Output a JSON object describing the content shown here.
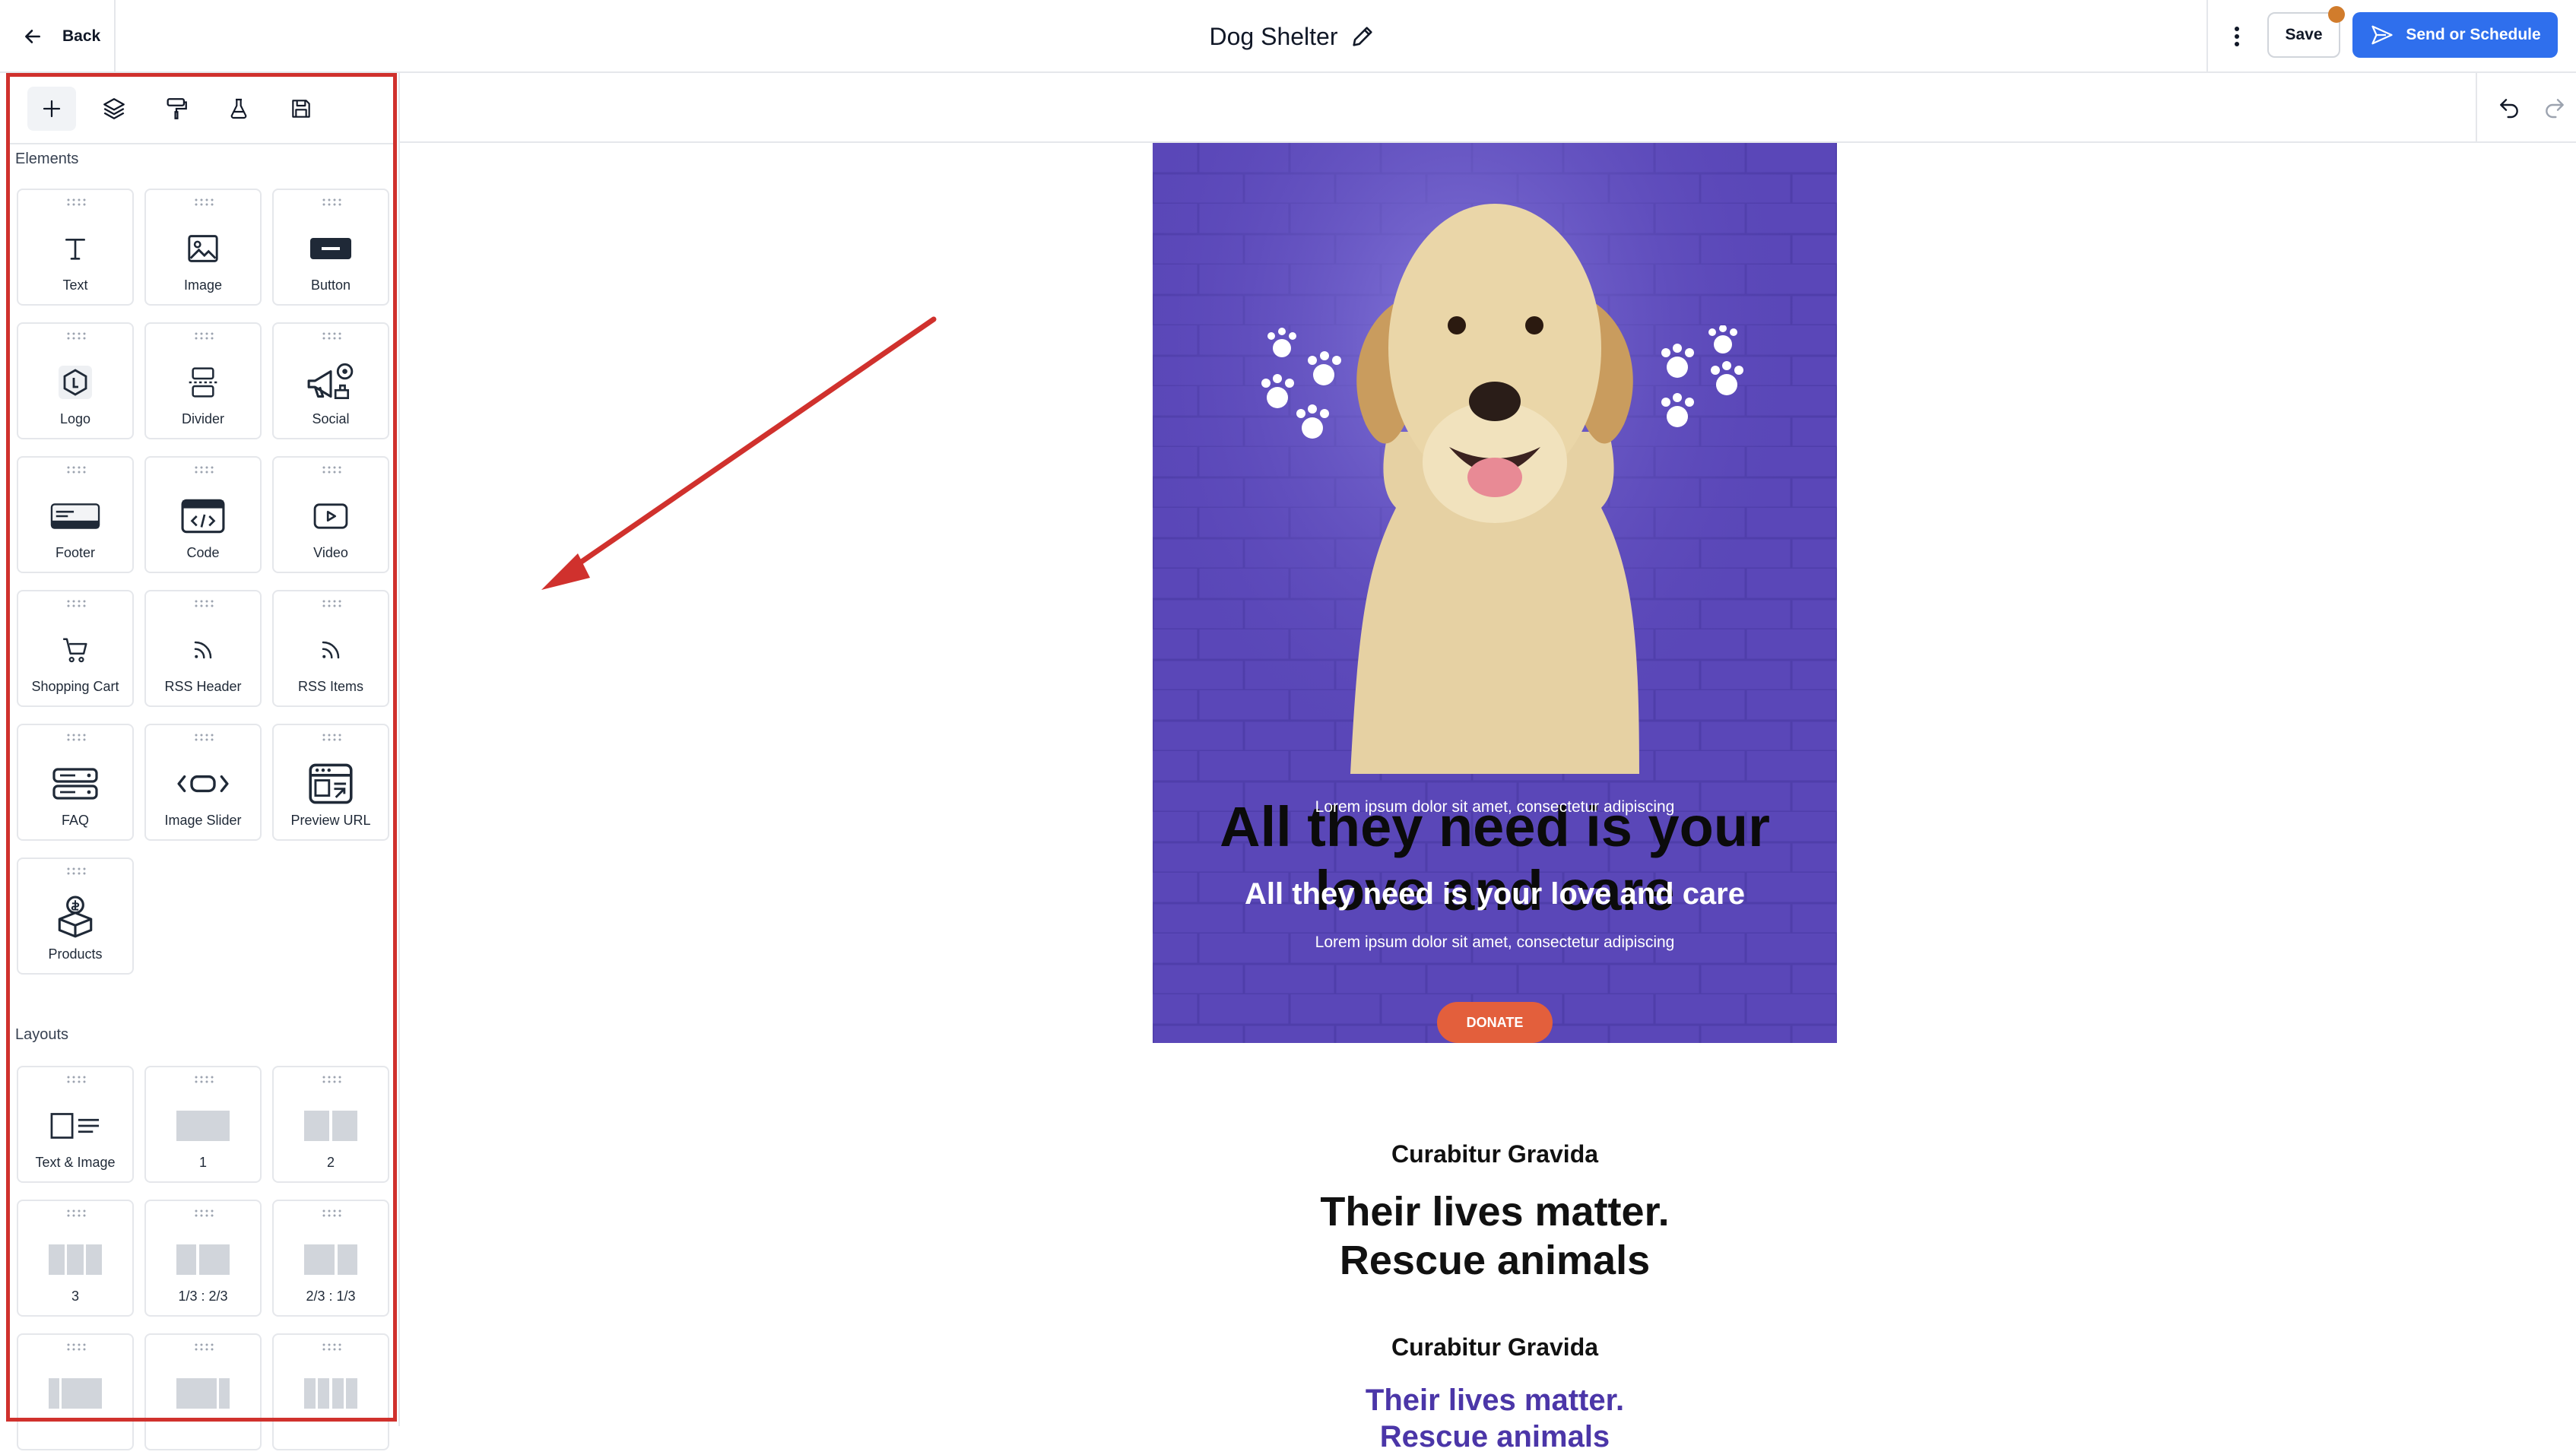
{
  "header": {
    "back_label": "Back",
    "title": "Dog Shelter",
    "save_label": "Save",
    "send_label": "Send or Schedule"
  },
  "sidebar": {
    "elements_label": "Elements",
    "layouts_label": "Layouts",
    "elements": [
      {
        "label": "Text",
        "icon": "text-icon"
      },
      {
        "label": "Image",
        "icon": "image-icon"
      },
      {
        "label": "Button",
        "icon": "button-icon"
      },
      {
        "label": "Logo",
        "icon": "logo-icon"
      },
      {
        "label": "Divider",
        "icon": "divider-icon"
      },
      {
        "label": "Social",
        "icon": "social-icon"
      },
      {
        "label": "Footer",
        "icon": "footer-icon"
      },
      {
        "label": "Code",
        "icon": "code-icon"
      },
      {
        "label": "Video",
        "icon": "video-icon"
      },
      {
        "label": "Shopping Cart",
        "icon": "shopping-cart-icon"
      },
      {
        "label": "RSS Header",
        "icon": "rss-icon"
      },
      {
        "label": "RSS Items",
        "icon": "rss-icon"
      },
      {
        "label": "FAQ",
        "icon": "faq-icon"
      },
      {
        "label": "Image Slider",
        "icon": "image-slider-icon"
      },
      {
        "label": "Preview URL",
        "icon": "preview-url-icon"
      },
      {
        "label": "Products",
        "icon": "products-icon"
      }
    ],
    "layouts": [
      {
        "label": "Text & Image"
      },
      {
        "label": "1"
      },
      {
        "label": "2"
      },
      {
        "label": "3"
      },
      {
        "label": "1/3 : 2/3"
      },
      {
        "label": "2/3 : 1/3"
      },
      {
        "label": ""
      },
      {
        "label": ""
      },
      {
        "label": ""
      }
    ]
  },
  "email": {
    "hero_heading": "All they need is your love and care",
    "hero_sub1": "Lorem ipsum dolor sit amet, consectetur adipiscing",
    "hero_heading2": "All they need is your love and care",
    "hero_sub2": "Lorem ipsum dolor sit amet, consectetur adipiscing",
    "donate_label": "DONATE",
    "kicker1": "Curabitur Gravida",
    "tagline1_line1": "Their lives matter.",
    "tagline1_line2": "Rescue animals",
    "kicker2": "Curabitur Gravida",
    "tagline2_line1": "Their lives matter.",
    "tagline2_line2": "Rescue animals"
  },
  "colors": {
    "accent": "#2f6fed",
    "hero_bg": "#5a47b8",
    "donate": "#e35f3c",
    "annotation": "#d0312d",
    "notification_dot": "#d17c2c"
  }
}
